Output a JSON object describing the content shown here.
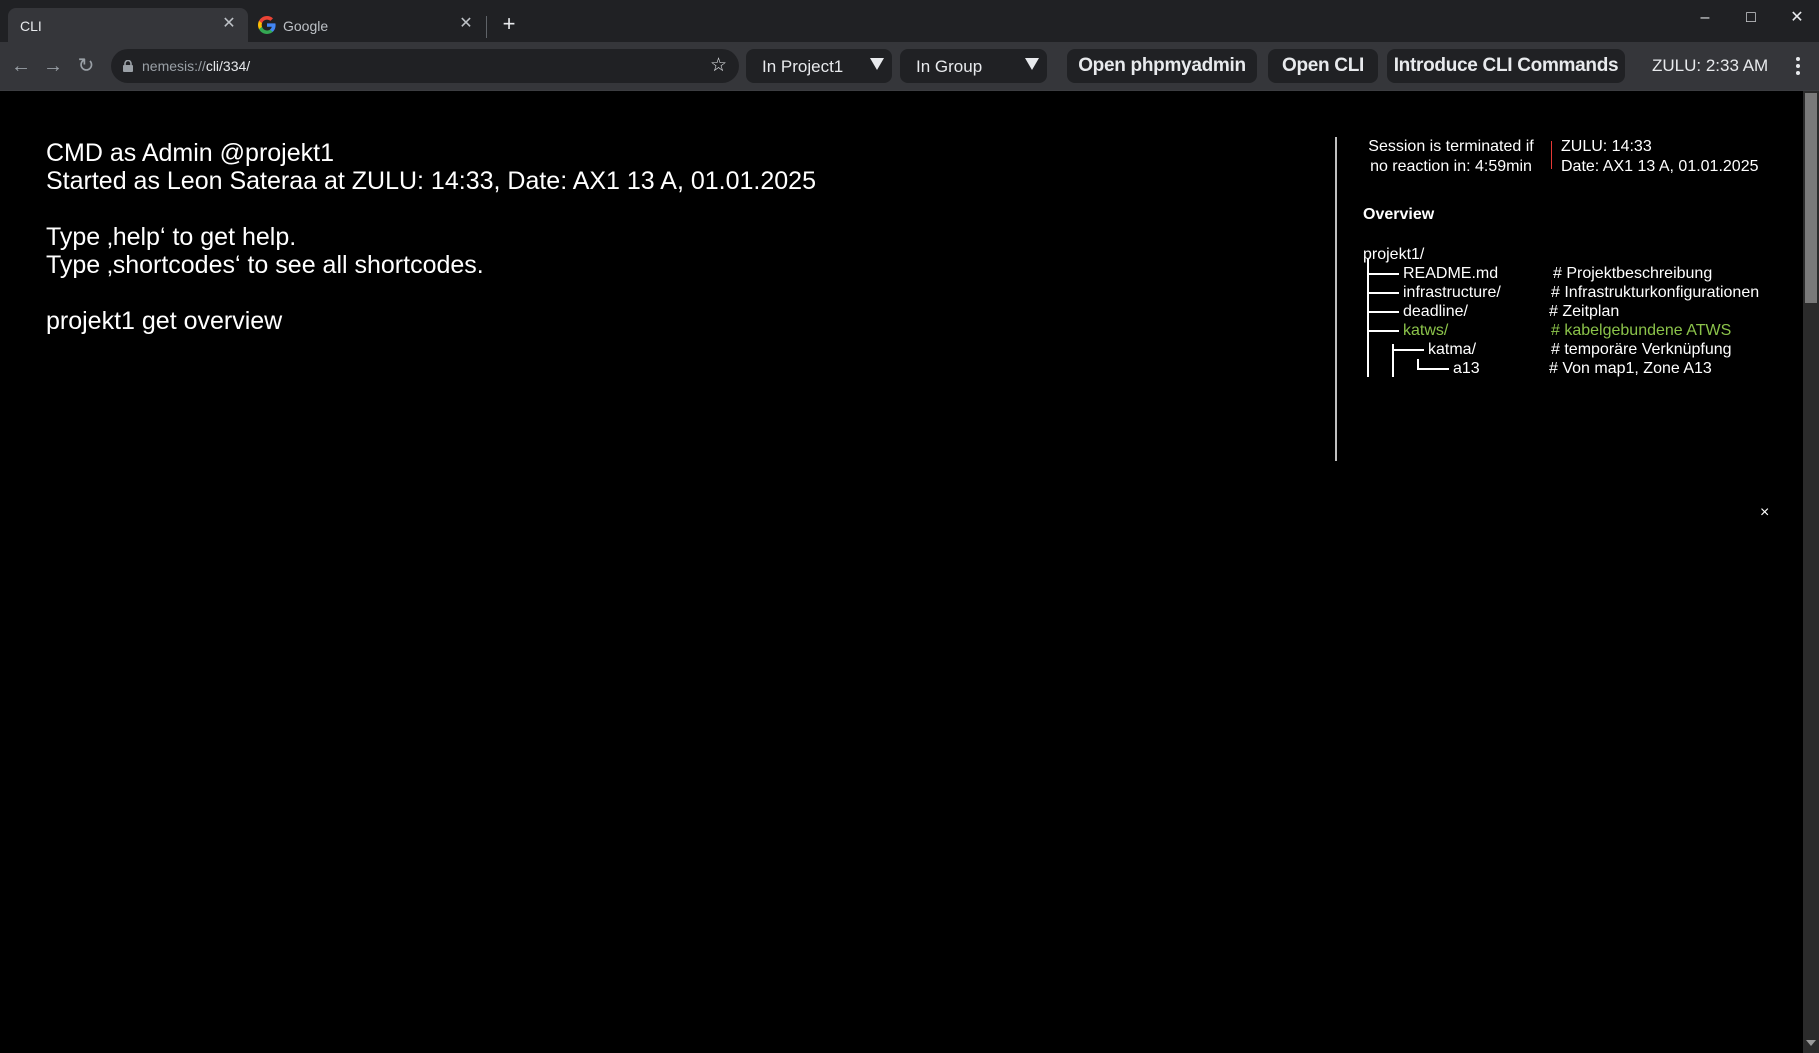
{
  "browser": {
    "tabs": [
      {
        "title": "CLI",
        "active": true
      },
      {
        "title": "Google",
        "active": false
      }
    ],
    "new_tab": "+",
    "window_controls": {
      "minimize": "–",
      "maximize": "□",
      "close": "✕"
    },
    "address": {
      "scheme": "nemesis://",
      "path": "cli/334/"
    }
  },
  "toolbar": {
    "project_select": "In Project1",
    "group_select": "In Group",
    "phpmyadmin_button": "Open phpmyadmin",
    "cli_button": "Open CLI",
    "introduce_button": "Introduce CLI Commands",
    "clock": "ZULU: 2:33 AM"
  },
  "terminal": {
    "lines": [
      "CMD as Admin @projekt1",
      "Started as Leon Sateraa at ZULU: 14:33, Date: AX1 13 A, 01.01.2025",
      "",
      "Type ‚help‘ to get help.",
      "Type ‚shortcodes‘ to see all shortcodes.",
      "",
      "projekt1 get overview"
    ]
  },
  "panel": {
    "session_text": [
      "Session is terminated if",
      "no reaction in: 4:59min"
    ],
    "zulu": "ZULU: 14:33",
    "date": "Date: AX1 13 A, 01.01.2025",
    "overview_title": "Overview",
    "tree": {
      "root": "projekt1/",
      "items": [
        {
          "name": "README.md",
          "comment": "# Projektbeschreibung",
          "highlight": false
        },
        {
          "name": "infrastructure/",
          "comment": "# Infrastrukturkonfigurationen",
          "highlight": false
        },
        {
          "name": "deadline/",
          "comment": "# Zeitplan",
          "highlight": false
        },
        {
          "name": "katws/",
          "comment": "# kabelgebundene ATWS",
          "highlight": true
        },
        {
          "name": "katma/",
          "comment": "# temporäre Verknüpfung",
          "highlight": false
        },
        {
          "name": "a13",
          "comment": "# Von map1, Zone A13",
          "highlight": false
        }
      ]
    },
    "close": "×"
  },
  "colors": {
    "background": "#000000",
    "highlight": "#8bc34a",
    "separator": "#e53935",
    "toolbar": "#35363a"
  }
}
